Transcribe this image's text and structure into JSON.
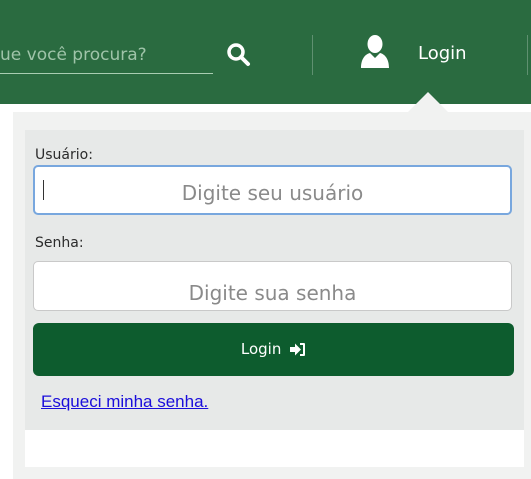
{
  "header": {
    "search_text": "ue você procura?",
    "login_label": "Login"
  },
  "form": {
    "username_label": "Usuário:",
    "username_placeholder": "Digite seu usuário",
    "password_label": "Senha:",
    "password_placeholder": "Digite sua senha",
    "submit_label": "Login",
    "forgot_link": "Esqueci minha senha."
  },
  "colors": {
    "nav_green": "#2a6b40",
    "button_green": "#0d5c2e",
    "focus_border": "#78a7de",
    "link_blue": "#1a0ddb"
  },
  "icons": [
    "search-icon",
    "user-icon",
    "sign-in-icon"
  ]
}
